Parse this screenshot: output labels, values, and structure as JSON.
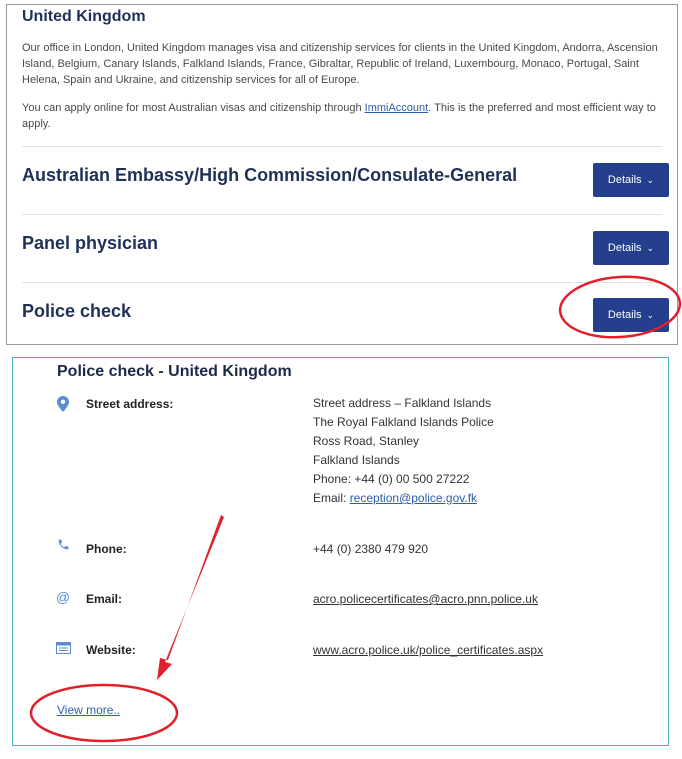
{
  "country": {
    "title": "United Kingdom",
    "description": "Our office in London, United Kingdom manages visa and citizenship services for clients in the United Kingdom, Andorra, Ascension Island, Belgium, Canary Islands, Falkland Islands, France, Gibraltar, Republic of Ireland, Luxembourg, Monaco, Portugal, Saint Helena, Spain and Ukraine, and citizenship services for all of Europe.",
    "apply_before": "You can apply online for most Australian visas and citizenship through ",
    "apply_link": "ImmiAccount",
    "apply_after": ". This is the preferred and most efficient way to apply."
  },
  "sections": [
    {
      "title": "Australian Embassy/High Commission/Consulate-General",
      "button": "Details"
    },
    {
      "title": "Panel physician",
      "button": "Details"
    },
    {
      "title": "Police check",
      "button": "Details"
    }
  ],
  "police_check": {
    "title": "Police check - United Kingdom",
    "street_label": "Street address:",
    "street_lines": [
      "Street address – Falkland Islands",
      "The Royal Falkland Islands Police",
      "Ross Road, Stanley",
      "Falkland Islands",
      "Phone: +44 (0) 00 500 27222"
    ],
    "street_email_prefix": "Email: ",
    "street_email": "reception@police.gov.fk",
    "phone_label": "Phone:",
    "phone_value": "+44 (0) 2380 479 920",
    "email_label": "Email:",
    "email_value": "acro.policecertificates@acro.pnn.police.uk",
    "website_label": "Website:",
    "website_value": "www.acro.police.uk/police_certificates.aspx",
    "view_more": "View more.."
  },
  "icons": {
    "street": "location-pin-icon",
    "phone": "phone-icon",
    "email": "at-sign-icon",
    "website": "browser-window-icon"
  },
  "annotation_color": "#e0202a"
}
